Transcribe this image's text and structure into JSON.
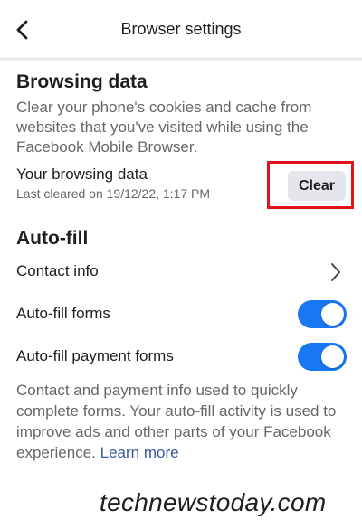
{
  "header": {
    "title": "Browser settings",
    "back_icon": "chevron-left-icon"
  },
  "browsing_data": {
    "title": "Browsing data",
    "description": "Clear your phone's cookies and cache from websites that you've visited while using the Facebook Mobile Browser.",
    "label": "Your browsing data",
    "last_cleared": "Last cleared on 19/12/22, 1:17 PM",
    "clear_button": "Clear",
    "highlight_color": "#e0131a"
  },
  "autofill": {
    "title": "Auto-fill",
    "contact_info": "Contact info",
    "forms": {
      "label": "Auto-fill forms",
      "on": true
    },
    "payment_forms": {
      "label": "Auto-fill payment forms",
      "on": true
    },
    "note": "Contact and payment info used to quickly complete forms. Your auto-fill activity is used to improve ads and other parts of your Facebook experience.",
    "learn_more": "Learn more",
    "toggle_color": "#1877f2"
  },
  "watermark": "technewstoday.com"
}
